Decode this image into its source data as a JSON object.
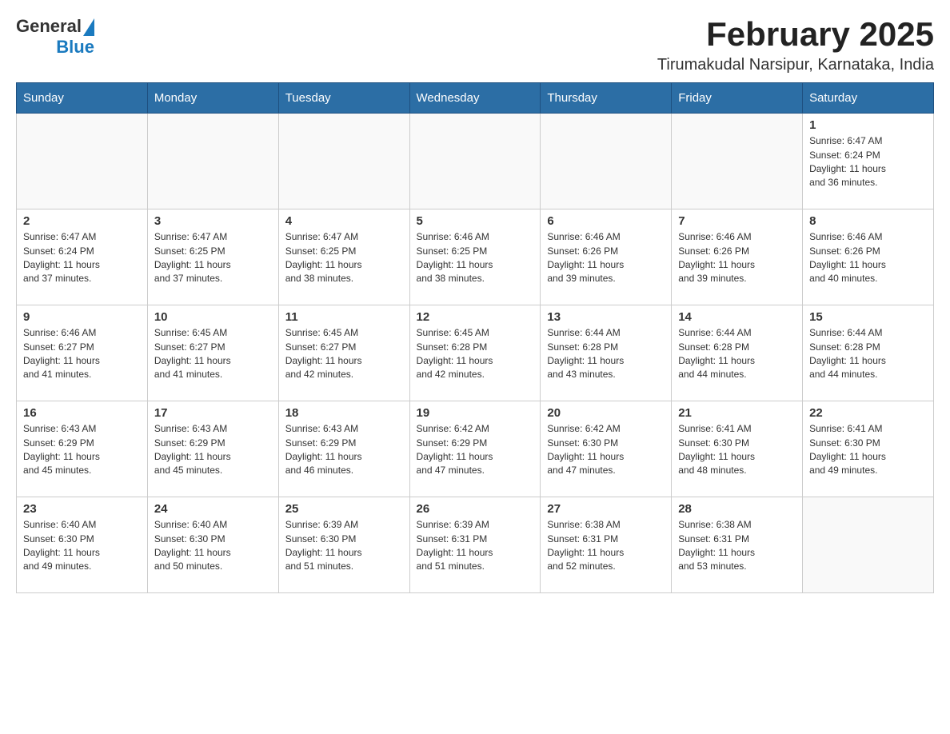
{
  "header": {
    "logo_general": "General",
    "logo_blue": "Blue",
    "title": "February 2025",
    "subtitle": "Tirumakudal Narsipur, Karnataka, India"
  },
  "weekdays": [
    "Sunday",
    "Monday",
    "Tuesday",
    "Wednesday",
    "Thursday",
    "Friday",
    "Saturday"
  ],
  "weeks": [
    [
      {
        "day": "",
        "info": ""
      },
      {
        "day": "",
        "info": ""
      },
      {
        "day": "",
        "info": ""
      },
      {
        "day": "",
        "info": ""
      },
      {
        "day": "",
        "info": ""
      },
      {
        "day": "",
        "info": ""
      },
      {
        "day": "1",
        "info": "Sunrise: 6:47 AM\nSunset: 6:24 PM\nDaylight: 11 hours\nand 36 minutes."
      }
    ],
    [
      {
        "day": "2",
        "info": "Sunrise: 6:47 AM\nSunset: 6:24 PM\nDaylight: 11 hours\nand 37 minutes."
      },
      {
        "day": "3",
        "info": "Sunrise: 6:47 AM\nSunset: 6:25 PM\nDaylight: 11 hours\nand 37 minutes."
      },
      {
        "day": "4",
        "info": "Sunrise: 6:47 AM\nSunset: 6:25 PM\nDaylight: 11 hours\nand 38 minutes."
      },
      {
        "day": "5",
        "info": "Sunrise: 6:46 AM\nSunset: 6:25 PM\nDaylight: 11 hours\nand 38 minutes."
      },
      {
        "day": "6",
        "info": "Sunrise: 6:46 AM\nSunset: 6:26 PM\nDaylight: 11 hours\nand 39 minutes."
      },
      {
        "day": "7",
        "info": "Sunrise: 6:46 AM\nSunset: 6:26 PM\nDaylight: 11 hours\nand 39 minutes."
      },
      {
        "day": "8",
        "info": "Sunrise: 6:46 AM\nSunset: 6:26 PM\nDaylight: 11 hours\nand 40 minutes."
      }
    ],
    [
      {
        "day": "9",
        "info": "Sunrise: 6:46 AM\nSunset: 6:27 PM\nDaylight: 11 hours\nand 41 minutes."
      },
      {
        "day": "10",
        "info": "Sunrise: 6:45 AM\nSunset: 6:27 PM\nDaylight: 11 hours\nand 41 minutes."
      },
      {
        "day": "11",
        "info": "Sunrise: 6:45 AM\nSunset: 6:27 PM\nDaylight: 11 hours\nand 42 minutes."
      },
      {
        "day": "12",
        "info": "Sunrise: 6:45 AM\nSunset: 6:28 PM\nDaylight: 11 hours\nand 42 minutes."
      },
      {
        "day": "13",
        "info": "Sunrise: 6:44 AM\nSunset: 6:28 PM\nDaylight: 11 hours\nand 43 minutes."
      },
      {
        "day": "14",
        "info": "Sunrise: 6:44 AM\nSunset: 6:28 PM\nDaylight: 11 hours\nand 44 minutes."
      },
      {
        "day": "15",
        "info": "Sunrise: 6:44 AM\nSunset: 6:28 PM\nDaylight: 11 hours\nand 44 minutes."
      }
    ],
    [
      {
        "day": "16",
        "info": "Sunrise: 6:43 AM\nSunset: 6:29 PM\nDaylight: 11 hours\nand 45 minutes."
      },
      {
        "day": "17",
        "info": "Sunrise: 6:43 AM\nSunset: 6:29 PM\nDaylight: 11 hours\nand 45 minutes."
      },
      {
        "day": "18",
        "info": "Sunrise: 6:43 AM\nSunset: 6:29 PM\nDaylight: 11 hours\nand 46 minutes."
      },
      {
        "day": "19",
        "info": "Sunrise: 6:42 AM\nSunset: 6:29 PM\nDaylight: 11 hours\nand 47 minutes."
      },
      {
        "day": "20",
        "info": "Sunrise: 6:42 AM\nSunset: 6:30 PM\nDaylight: 11 hours\nand 47 minutes."
      },
      {
        "day": "21",
        "info": "Sunrise: 6:41 AM\nSunset: 6:30 PM\nDaylight: 11 hours\nand 48 minutes."
      },
      {
        "day": "22",
        "info": "Sunrise: 6:41 AM\nSunset: 6:30 PM\nDaylight: 11 hours\nand 49 minutes."
      }
    ],
    [
      {
        "day": "23",
        "info": "Sunrise: 6:40 AM\nSunset: 6:30 PM\nDaylight: 11 hours\nand 49 minutes."
      },
      {
        "day": "24",
        "info": "Sunrise: 6:40 AM\nSunset: 6:30 PM\nDaylight: 11 hours\nand 50 minutes."
      },
      {
        "day": "25",
        "info": "Sunrise: 6:39 AM\nSunset: 6:30 PM\nDaylight: 11 hours\nand 51 minutes."
      },
      {
        "day": "26",
        "info": "Sunrise: 6:39 AM\nSunset: 6:31 PM\nDaylight: 11 hours\nand 51 minutes."
      },
      {
        "day": "27",
        "info": "Sunrise: 6:38 AM\nSunset: 6:31 PM\nDaylight: 11 hours\nand 52 minutes."
      },
      {
        "day": "28",
        "info": "Sunrise: 6:38 AM\nSunset: 6:31 PM\nDaylight: 11 hours\nand 53 minutes."
      },
      {
        "day": "",
        "info": ""
      }
    ]
  ]
}
